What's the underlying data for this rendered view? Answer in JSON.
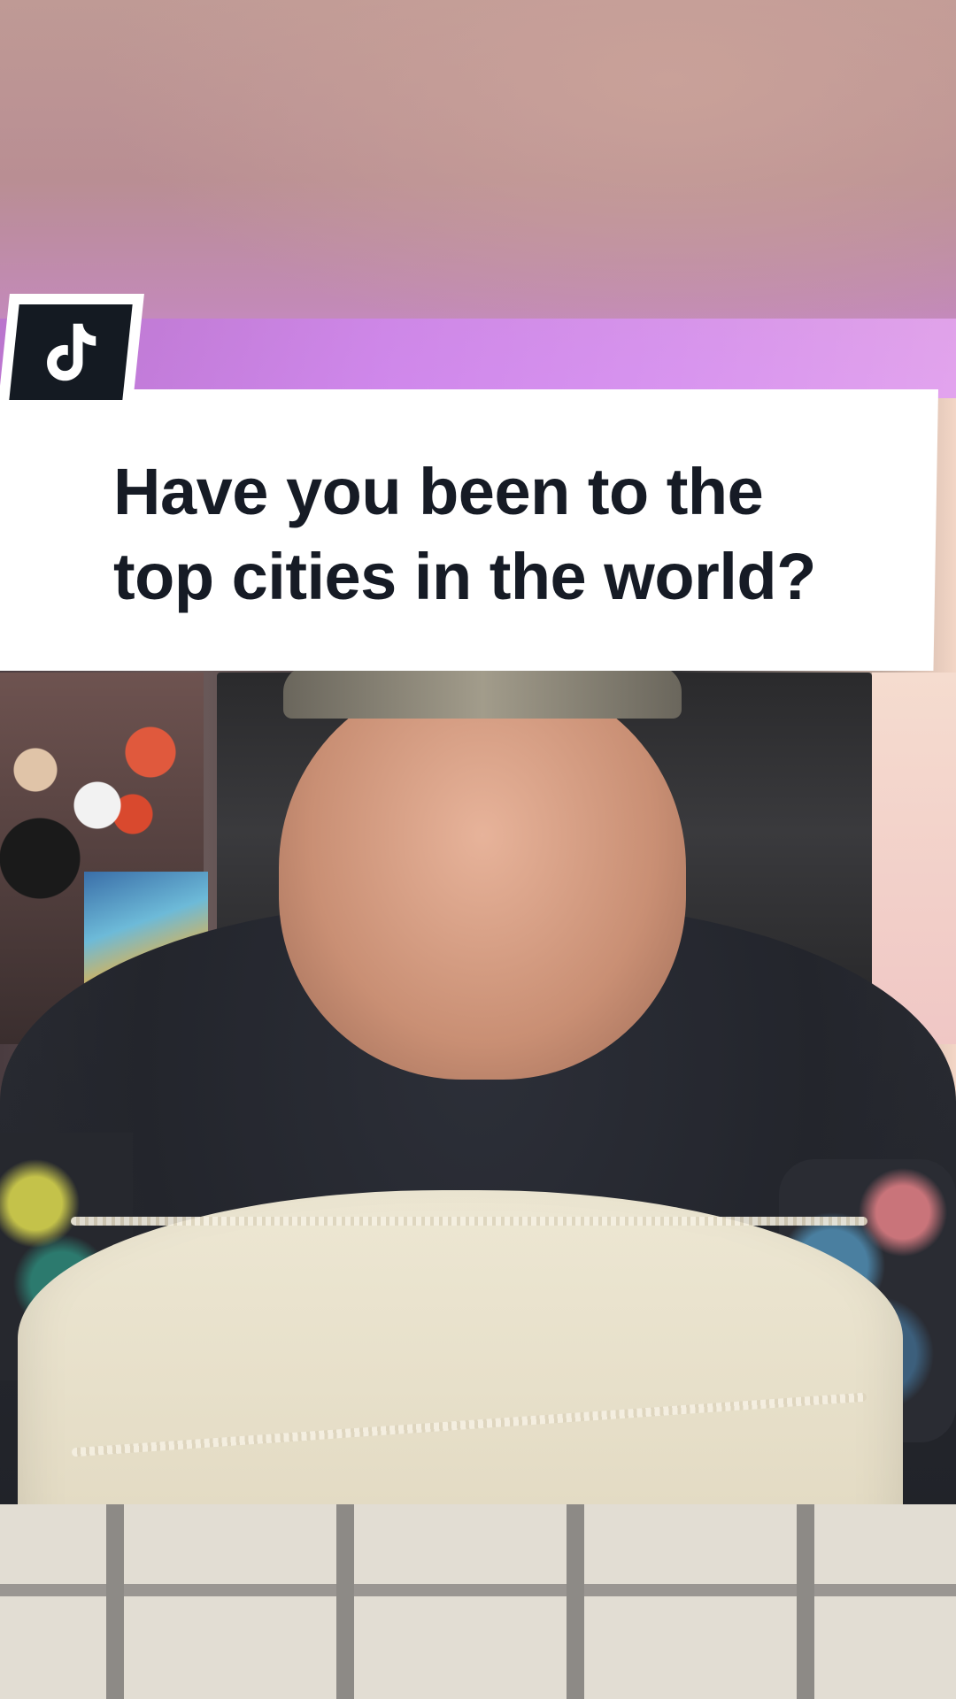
{
  "caption": {
    "line1": "Have you been to the",
    "line2": "top cities in the world?"
  },
  "branding": {
    "logo_icon": "tiktok-note-icon",
    "logo_background": "#141a22",
    "caption_background": "#ffffff",
    "caption_text_color": "#161b25"
  }
}
